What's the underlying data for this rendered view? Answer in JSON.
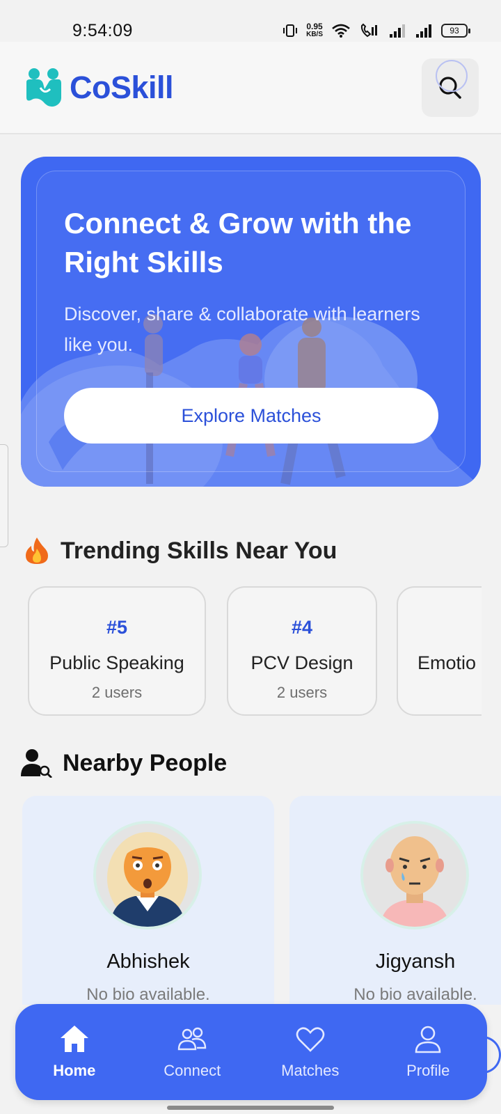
{
  "status_bar": {
    "time": "9:54:09",
    "net_speed_value": "0.95",
    "net_speed_unit": "KB/S",
    "battery": "93"
  },
  "header": {
    "app_name": "CoSkill",
    "brand_color": "#2b50d9",
    "logo_color": "#1fbfbf"
  },
  "hero": {
    "title": "Connect & Grow with the Right Skills",
    "subtitle": "Discover, share & collaborate with learners like you.",
    "cta_label": "Explore Matches",
    "background_color": "#3f68f2"
  },
  "trending": {
    "heading": "Trending Skills Near You",
    "icon": "fire-icon",
    "skills": [
      {
        "rank": "#5",
        "name": "Public Speaking",
        "users": "2 users"
      },
      {
        "rank": "#4",
        "name": "PCV Design",
        "users": "2 users"
      },
      {
        "rank": "",
        "name": "Emotio",
        "users": ""
      }
    ]
  },
  "nearby": {
    "heading": "Nearby People",
    "icon": "person-search-icon",
    "people": [
      {
        "name": "Abhishek",
        "bio": "No bio available."
      },
      {
        "name": "Jigyansh",
        "bio": "No bio available."
      }
    ]
  },
  "nav": {
    "items": [
      {
        "label": "Home",
        "icon": "home-icon",
        "active": true
      },
      {
        "label": "Connect",
        "icon": "people-icon",
        "active": false
      },
      {
        "label": "Matches",
        "icon": "heart-icon",
        "active": false
      },
      {
        "label": "Profile",
        "icon": "user-icon",
        "active": false
      }
    ]
  }
}
